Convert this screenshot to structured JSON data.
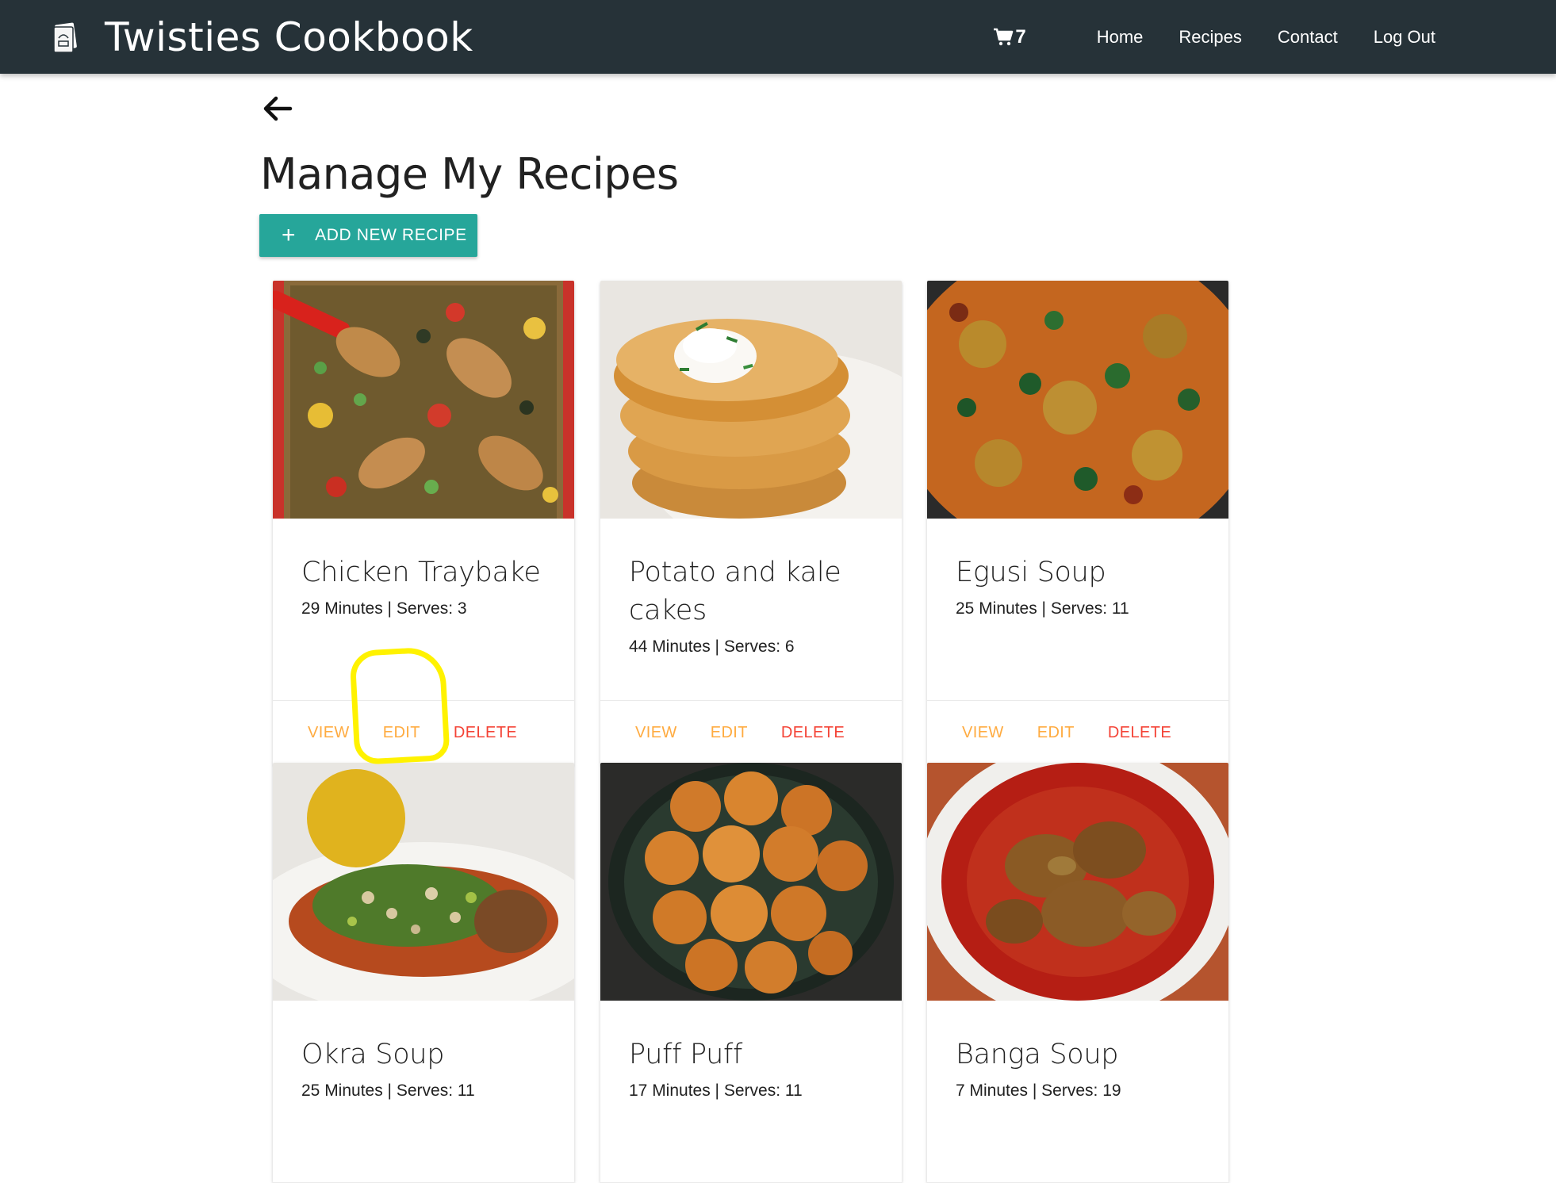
{
  "navbar": {
    "brand_title": "Twisties Cookbook",
    "cart_count": "7",
    "links": [
      "Home",
      "Recipes",
      "Contact",
      "Log Out"
    ]
  },
  "main": {
    "page_title": "Manage My Recipes",
    "add_button_label": "ADD NEW RECIPE",
    "recipes": [
      {
        "title": "Chicken Traybake",
        "meta": "29 Minutes | Serves: 3",
        "image": "chicken-traybake-photo"
      },
      {
        "title": "Potato and kale cakes",
        "meta": "44 Minutes | Serves: 6",
        "image": "potato-kale-cakes-photo"
      },
      {
        "title": "Egusi Soup",
        "meta": "25 Minutes | Serves: 11",
        "image": "egusi-soup-photo"
      },
      {
        "title": "Okra Soup",
        "meta": "25 Minutes | Serves: 11",
        "image": "okra-soup-photo"
      },
      {
        "title": "Puff Puff",
        "meta": "17 Minutes | Serves: 11",
        "image": "puff-puff-photo"
      },
      {
        "title": "Banga Soup",
        "meta": "7 Minutes | Serves: 19",
        "image": "banga-soup-photo"
      }
    ],
    "actions": {
      "view": "VIEW",
      "edit": "EDIT",
      "delete": "DELETE"
    }
  },
  "colors": {
    "navbar": "#263238",
    "accent": "#26a69a",
    "action_orange": "#ffab40",
    "delete_red": "#f44336",
    "annotation_yellow": "#fff200"
  }
}
